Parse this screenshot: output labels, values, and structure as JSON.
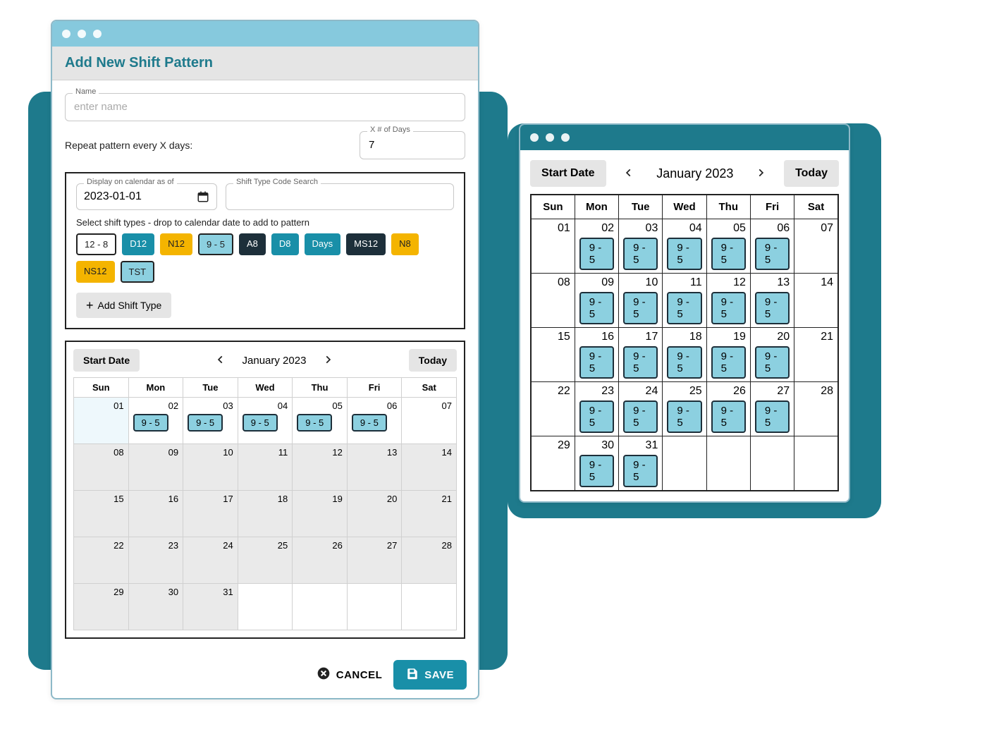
{
  "left": {
    "title": "Add New Shift Pattern",
    "name_legend": "Name",
    "name_placeholder": "enter name",
    "repeat_label": "Repeat pattern every X days:",
    "days_legend": "X # of Days",
    "days_value": "7",
    "display_legend": "Display on calendar as of",
    "display_value": "2023-01-01",
    "search_legend": "Shift Type Code Search",
    "hint": "Select shift types - drop to calendar date to add to pattern",
    "chips": [
      {
        "label": "12 - 8",
        "cls": "white"
      },
      {
        "label": "D12",
        "cls": "teal"
      },
      {
        "label": "N12",
        "cls": "yellow"
      },
      {
        "label": "9 - 5",
        "cls": "light"
      },
      {
        "label": "A8",
        "cls": "navy"
      },
      {
        "label": "D8",
        "cls": "teal"
      },
      {
        "label": "Days",
        "cls": "teal"
      },
      {
        "label": "MS12",
        "cls": "navy"
      },
      {
        "label": "N8",
        "cls": "yellow"
      },
      {
        "label": "NS12",
        "cls": "yellow"
      },
      {
        "label": "TST",
        "cls": "light"
      }
    ],
    "add_shift_type": "Add Shift Type",
    "start_date": "Start Date",
    "today": "Today",
    "month": "January 2023",
    "dow": [
      "Sun",
      "Mon",
      "Tue",
      "Wed",
      "Thu",
      "Fri",
      "Sat"
    ],
    "weeks": [
      [
        {
          "n": "01",
          "today": true
        },
        {
          "n": "02",
          "shift": "9 - 5"
        },
        {
          "n": "03",
          "shift": "9 - 5"
        },
        {
          "n": "04",
          "shift": "9 - 5"
        },
        {
          "n": "05",
          "shift": "9 - 5"
        },
        {
          "n": "06",
          "shift": "9 - 5"
        },
        {
          "n": "07"
        }
      ],
      [
        {
          "n": "08",
          "grey": true
        },
        {
          "n": "09",
          "grey": true
        },
        {
          "n": "10",
          "grey": true
        },
        {
          "n": "11",
          "grey": true
        },
        {
          "n": "12",
          "grey": true
        },
        {
          "n": "13",
          "grey": true
        },
        {
          "n": "14",
          "grey": true
        }
      ],
      [
        {
          "n": "15",
          "grey": true
        },
        {
          "n": "16",
          "grey": true
        },
        {
          "n": "17",
          "grey": true
        },
        {
          "n": "18",
          "grey": true
        },
        {
          "n": "19",
          "grey": true
        },
        {
          "n": "20",
          "grey": true
        },
        {
          "n": "21",
          "grey": true
        }
      ],
      [
        {
          "n": "22",
          "grey": true
        },
        {
          "n": "23",
          "grey": true
        },
        {
          "n": "24",
          "grey": true
        },
        {
          "n": "25",
          "grey": true
        },
        {
          "n": "26",
          "grey": true
        },
        {
          "n": "27",
          "grey": true
        },
        {
          "n": "28",
          "grey": true
        }
      ],
      [
        {
          "n": "29",
          "grey": true
        },
        {
          "n": "30",
          "grey": true
        },
        {
          "n": "31",
          "grey": true
        },
        {},
        {},
        {},
        {}
      ]
    ],
    "cancel": "CANCEL",
    "save": "SAVE"
  },
  "right": {
    "start_date": "Start Date",
    "today": "Today",
    "month": "January 2023",
    "dow": [
      "Sun",
      "Mon",
      "Tue",
      "Wed",
      "Thu",
      "Fri",
      "Sat"
    ],
    "weeks": [
      [
        {
          "n": "01"
        },
        {
          "n": "02",
          "shift": "9 - 5"
        },
        {
          "n": "03",
          "shift": "9 - 5"
        },
        {
          "n": "04",
          "shift": "9 - 5"
        },
        {
          "n": "05",
          "shift": "9 - 5"
        },
        {
          "n": "06",
          "shift": "9 - 5"
        },
        {
          "n": "07"
        }
      ],
      [
        {
          "n": "08"
        },
        {
          "n": "09",
          "shift": "9 - 5"
        },
        {
          "n": "10",
          "shift": "9 - 5"
        },
        {
          "n": "11",
          "shift": "9 - 5"
        },
        {
          "n": "12",
          "shift": "9 - 5"
        },
        {
          "n": "13",
          "shift": "9 - 5"
        },
        {
          "n": "14"
        }
      ],
      [
        {
          "n": "15"
        },
        {
          "n": "16",
          "shift": "9 - 5"
        },
        {
          "n": "17",
          "shift": "9 - 5"
        },
        {
          "n": "18",
          "shift": "9 - 5"
        },
        {
          "n": "19",
          "shift": "9 - 5"
        },
        {
          "n": "20",
          "shift": "9 - 5"
        },
        {
          "n": "21"
        }
      ],
      [
        {
          "n": "22"
        },
        {
          "n": "23",
          "shift": "9 - 5"
        },
        {
          "n": "24",
          "shift": "9 - 5"
        },
        {
          "n": "25",
          "shift": "9 - 5"
        },
        {
          "n": "26",
          "shift": "9 - 5"
        },
        {
          "n": "27",
          "shift": "9 - 5"
        },
        {
          "n": "28"
        }
      ],
      [
        {
          "n": "29"
        },
        {
          "n": "30",
          "shift": "9 - 5"
        },
        {
          "n": "31",
          "shift": "9 - 5"
        },
        {},
        {},
        {},
        {}
      ]
    ]
  }
}
